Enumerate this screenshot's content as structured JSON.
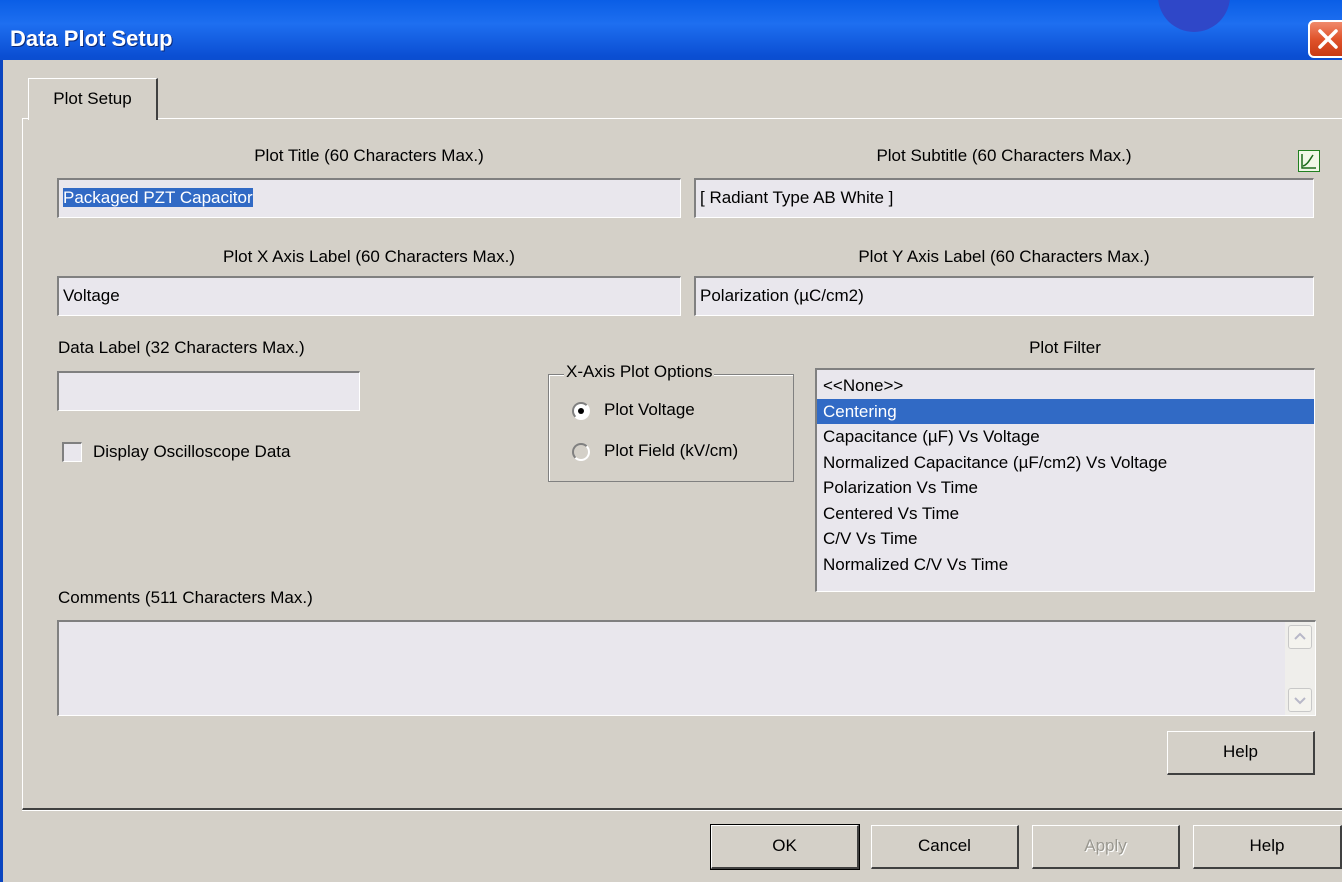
{
  "window": {
    "title": "Data Plot Setup"
  },
  "tabs": [
    {
      "label": "Plot Setup",
      "active": true
    }
  ],
  "form": {
    "plot_title": {
      "label": "Plot Title (60 Characters Max.)",
      "value": "Packaged PZT Capacitor"
    },
    "plot_subtitle": {
      "label": "Plot Subtitle (60 Characters Max.)",
      "value": "[ Radiant Type AB White ]"
    },
    "x_axis_label": {
      "label": "Plot X Axis Label (60 Characters Max.)",
      "value": "Voltage"
    },
    "y_axis_label": {
      "label": "Plot Y Axis Label (60 Characters Max.)",
      "value": "Polarization (µC/cm2)"
    },
    "data_label": {
      "label": "Data Label (32 Characters Max.)",
      "value": ""
    },
    "display_oscilloscope": {
      "label": "Display Oscilloscope Data",
      "checked": false
    },
    "x_axis_options": {
      "legend": "X-Axis Plot Options",
      "options": [
        {
          "label": "Plot Voltage",
          "selected": true
        },
        {
          "label": "Plot Field (kV/cm)",
          "selected": false
        }
      ]
    },
    "plot_filter": {
      "label": "Plot Filter",
      "items": [
        "<<None>>",
        "Centering",
        "Capacitance (µF) Vs Voltage",
        "Normalized Capacitance (µF/cm2) Vs Voltage",
        "Polarization Vs Time",
        "Centered Vs Time",
        "C/V Vs Time",
        "Normalized C/V Vs Time"
      ],
      "selected_index": 1
    },
    "comments": {
      "label": "Comments (511 Characters Max.)",
      "value": ""
    }
  },
  "buttons": {
    "panel_help": "Help",
    "ok": "OK",
    "cancel": "Cancel",
    "apply": "Apply",
    "help": "Help"
  },
  "colors": {
    "title_bar": "#0a5ee6",
    "selection": "#316ac5",
    "close_button": "#e0532b",
    "dialog_face": "#d4d0c8"
  }
}
